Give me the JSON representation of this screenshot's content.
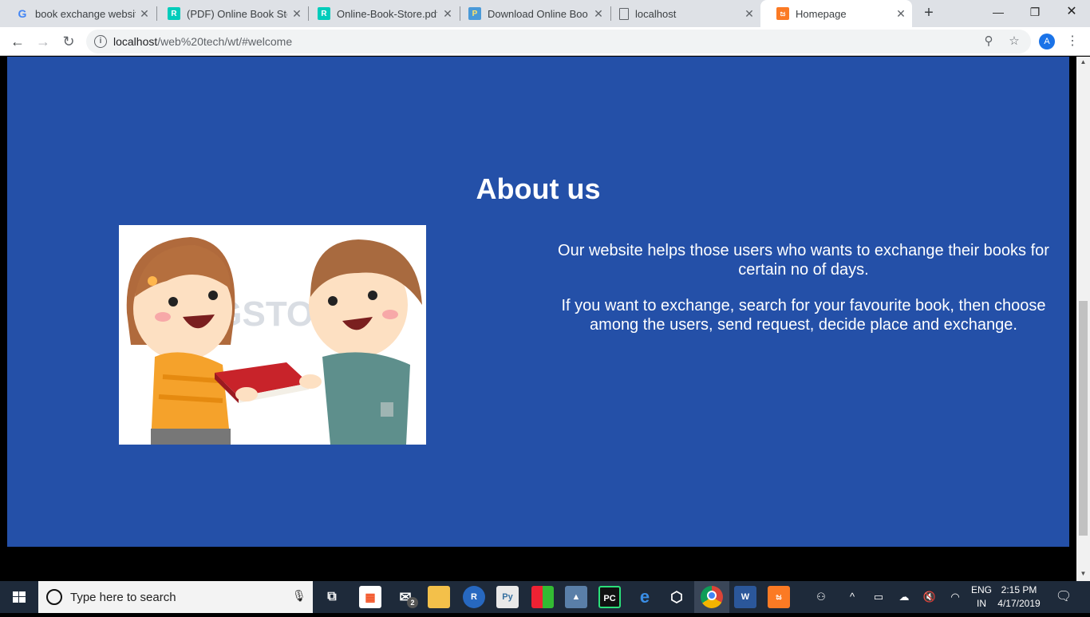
{
  "browser": {
    "tabs": [
      {
        "title": "book exchange website",
        "icon": "google-icon",
        "color": "#4285f4",
        "glyph": "G"
      },
      {
        "title": "(PDF) Online Book Store",
        "icon": "researchgate-icon",
        "color": "#00ccbb",
        "glyph": "R"
      },
      {
        "title": "Online-Book-Store.pdf",
        "icon": "researchgate-icon",
        "color": "#00ccbb",
        "glyph": "R"
      },
      {
        "title": "Download Online Book",
        "icon": "projects-icon",
        "color": "#4a9ad8",
        "glyph": "P"
      },
      {
        "title": "localhost",
        "icon": "page-icon",
        "color": "#5f6368",
        "glyph": ""
      },
      {
        "title": "Homepage",
        "icon": "xampp-icon",
        "color": "#fb7a24",
        "glyph": "ಜ"
      }
    ],
    "url_host": "localhost",
    "url_path": "/web%20tech/wt/#welcome",
    "avatar_letter": "A"
  },
  "page": {
    "about_title": "About us",
    "paragraph1": "Our website helps those users who wants to exchange their books for certain no of days.",
    "paragraph2": "If you want to exchange, search for your favourite book, then choose among the users, send request, decide place and exchange.",
    "image_watermark": "BIGSTOCK",
    "colors": {
      "section_bg": "#2450a8",
      "text": "#ffffff"
    }
  },
  "taskbar": {
    "search_placeholder": "Type here to search",
    "mail_badge": "2",
    "language_line1": "ENG",
    "language_line2": "IN",
    "time": "2:15 PM",
    "date": "4/17/2019"
  }
}
